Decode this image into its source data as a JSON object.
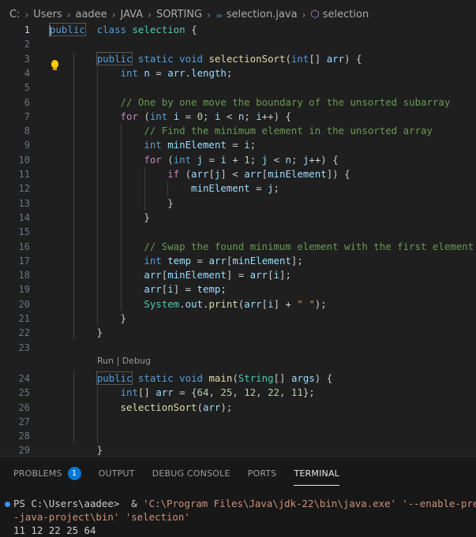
{
  "breadcrumb": {
    "drive": "C:",
    "folders": [
      "Users",
      "aadee",
      "JAVA",
      "SORTING"
    ],
    "file": "selection.java",
    "symbol": "selection",
    "file_icon": "java-file-icon",
    "symbol_icon": "class-symbol-icon"
  },
  "editor": {
    "codelens": "Run | Debug",
    "lines": [
      {
        "n": "1",
        "tokens": [
          [
            "kw hl",
            "public"
          ],
          [
            "",
            "  "
          ],
          [
            "kw",
            "class"
          ],
          [
            "",
            " "
          ],
          [
            "ty",
            "selection"
          ],
          [
            "",
            " {"
          ]
        ]
      },
      {
        "n": "2",
        "tokens": []
      },
      {
        "n": "3",
        "tokens": [
          [
            "",
            "        "
          ],
          [
            "kw hl",
            "public"
          ],
          [
            "",
            " "
          ],
          [
            "kw",
            "static"
          ],
          [
            "",
            " "
          ],
          [
            "kw",
            "void"
          ],
          [
            "",
            " "
          ],
          [
            "fn",
            "selectionSort"
          ],
          [
            "",
            "("
          ],
          [
            "kw",
            "int"
          ],
          [
            "",
            "[] "
          ],
          [
            "var",
            "arr"
          ],
          [
            "",
            ") {"
          ]
        ]
      },
      {
        "n": "4",
        "tokens": [
          [
            "",
            "            "
          ],
          [
            "kw",
            "int"
          ],
          [
            "",
            " "
          ],
          [
            "var",
            "n"
          ],
          [
            "",
            " = "
          ],
          [
            "var",
            "arr"
          ],
          [
            "",
            "."
          ],
          [
            "var",
            "length"
          ],
          [
            "",
            ";"
          ]
        ]
      },
      {
        "n": "5",
        "tokens": []
      },
      {
        "n": "6",
        "tokens": [
          [
            "",
            "            "
          ],
          [
            "cm",
            "// One by one move the boundary of the unsorted subarray"
          ]
        ]
      },
      {
        "n": "7",
        "tokens": [
          [
            "",
            "            "
          ],
          [
            "ctl",
            "for"
          ],
          [
            "",
            " ("
          ],
          [
            "kw",
            "int"
          ],
          [
            "",
            " "
          ],
          [
            "var",
            "i"
          ],
          [
            "",
            " = "
          ],
          [
            "num",
            "0"
          ],
          [
            "",
            "; "
          ],
          [
            "var",
            "i"
          ],
          [
            "",
            " < "
          ],
          [
            "var",
            "n"
          ],
          [
            "",
            "; "
          ],
          [
            "var",
            "i"
          ],
          [
            "",
            "++) {"
          ]
        ]
      },
      {
        "n": "8",
        "tokens": [
          [
            "",
            "                "
          ],
          [
            "cm",
            "// Find the minimum element in the unsorted array"
          ]
        ]
      },
      {
        "n": "9",
        "tokens": [
          [
            "",
            "                "
          ],
          [
            "kw",
            "int"
          ],
          [
            "",
            " "
          ],
          [
            "var",
            "minElement"
          ],
          [
            "",
            " = "
          ],
          [
            "var",
            "i"
          ],
          [
            "",
            ";"
          ]
        ]
      },
      {
        "n": "10",
        "tokens": [
          [
            "",
            "                "
          ],
          [
            "ctl",
            "for"
          ],
          [
            "",
            " ("
          ],
          [
            "kw",
            "int"
          ],
          [
            "",
            " "
          ],
          [
            "var",
            "j"
          ],
          [
            "",
            " = "
          ],
          [
            "var",
            "i"
          ],
          [
            "",
            " + "
          ],
          [
            "num",
            "1"
          ],
          [
            "",
            "; "
          ],
          [
            "var",
            "j"
          ],
          [
            "",
            " < "
          ],
          [
            "var",
            "n"
          ],
          [
            "",
            "; "
          ],
          [
            "var",
            "j"
          ],
          [
            "",
            "++) {"
          ]
        ]
      },
      {
        "n": "11",
        "tokens": [
          [
            "",
            "                    "
          ],
          [
            "ctl",
            "if"
          ],
          [
            "",
            " ("
          ],
          [
            "var",
            "arr"
          ],
          [
            "",
            "["
          ],
          [
            "var",
            "j"
          ],
          [
            "",
            "] < "
          ],
          [
            "var",
            "arr"
          ],
          [
            "",
            "["
          ],
          [
            "var",
            "minElement"
          ],
          [
            "",
            "]) {"
          ]
        ]
      },
      {
        "n": "12",
        "tokens": [
          [
            "",
            "                        "
          ],
          [
            "var",
            "minElement"
          ],
          [
            "",
            " = "
          ],
          [
            "var",
            "j"
          ],
          [
            "",
            ";"
          ]
        ]
      },
      {
        "n": "13",
        "tokens": [
          [
            "",
            "                    }"
          ]
        ]
      },
      {
        "n": "14",
        "tokens": [
          [
            "",
            "                }"
          ]
        ]
      },
      {
        "n": "15",
        "tokens": []
      },
      {
        "n": "16",
        "tokens": [
          [
            "",
            "                "
          ],
          [
            "cm",
            "// Swap the found minimum element with the first element"
          ]
        ]
      },
      {
        "n": "17",
        "tokens": [
          [
            "",
            "                "
          ],
          [
            "kw",
            "int"
          ],
          [
            "",
            " "
          ],
          [
            "var",
            "temp"
          ],
          [
            "",
            " = "
          ],
          [
            "var",
            "arr"
          ],
          [
            "",
            "["
          ],
          [
            "var",
            "minElement"
          ],
          [
            "",
            "];"
          ]
        ]
      },
      {
        "n": "18",
        "tokens": [
          [
            "",
            "                "
          ],
          [
            "var",
            "arr"
          ],
          [
            "",
            "["
          ],
          [
            "var",
            "minElement"
          ],
          [
            "",
            "] = "
          ],
          [
            "var",
            "arr"
          ],
          [
            "",
            "["
          ],
          [
            "var",
            "i"
          ],
          [
            "",
            "];"
          ]
        ]
      },
      {
        "n": "19",
        "tokens": [
          [
            "",
            "                "
          ],
          [
            "var",
            "arr"
          ],
          [
            "",
            "["
          ],
          [
            "var",
            "i"
          ],
          [
            "",
            "] = "
          ],
          [
            "var",
            "temp"
          ],
          [
            "",
            ";"
          ]
        ]
      },
      {
        "n": "20",
        "tokens": [
          [
            "",
            "                "
          ],
          [
            "ty",
            "System"
          ],
          [
            "",
            "."
          ],
          [
            "var",
            "out"
          ],
          [
            "",
            "."
          ],
          [
            "fn",
            "print"
          ],
          [
            "",
            "("
          ],
          [
            "var",
            "arr"
          ],
          [
            "",
            "["
          ],
          [
            "var",
            "i"
          ],
          [
            "",
            "] + "
          ],
          [
            "str",
            "\" \""
          ],
          [
            "",
            ");"
          ]
        ]
      },
      {
        "n": "21",
        "tokens": [
          [
            "",
            "            }"
          ]
        ]
      },
      {
        "n": "22",
        "tokens": [
          [
            "",
            "        }"
          ]
        ]
      },
      {
        "n": "23",
        "tokens": []
      },
      {
        "n": "24",
        "tokens": [
          [
            "",
            "        "
          ],
          [
            "kw hl",
            "public"
          ],
          [
            "",
            " "
          ],
          [
            "kw",
            "static"
          ],
          [
            "",
            " "
          ],
          [
            "kw",
            "void"
          ],
          [
            "",
            " "
          ],
          [
            "fn",
            "main"
          ],
          [
            "",
            "("
          ],
          [
            "ty",
            "String"
          ],
          [
            "",
            "[] "
          ],
          [
            "var",
            "args"
          ],
          [
            "",
            ") {"
          ]
        ]
      },
      {
        "n": "25",
        "tokens": [
          [
            "",
            "            "
          ],
          [
            "kw",
            "int"
          ],
          [
            "",
            "[] "
          ],
          [
            "var",
            "arr"
          ],
          [
            "",
            " = {"
          ],
          [
            "num",
            "64"
          ],
          [
            "",
            ", "
          ],
          [
            "num",
            "25"
          ],
          [
            "",
            ", "
          ],
          [
            "num",
            "12"
          ],
          [
            "",
            ", "
          ],
          [
            "num",
            "22"
          ],
          [
            "",
            ", "
          ],
          [
            "num",
            "11"
          ],
          [
            "",
            "};"
          ]
        ]
      },
      {
        "n": "26",
        "tokens": [
          [
            "",
            "            "
          ],
          [
            "fn",
            "selectionSort"
          ],
          [
            "",
            "("
          ],
          [
            "var",
            "arr"
          ],
          [
            "",
            ");"
          ]
        ]
      },
      {
        "n": "27",
        "tokens": []
      },
      {
        "n": "28",
        "tokens": []
      },
      {
        "n": "29",
        "tokens": [
          [
            "",
            "        }"
          ]
        ]
      }
    ]
  },
  "panel": {
    "tabs": [
      {
        "label": "PROBLEMS",
        "badge": "1"
      },
      {
        "label": "OUTPUT"
      },
      {
        "label": "DEBUG CONSOLE"
      },
      {
        "label": "PORTS"
      },
      {
        "label": "TERMINAL",
        "active": true
      }
    ],
    "terminal": {
      "prompt": "PS C:\\Users\\aadee> ",
      "command_amp": " & ",
      "command_exe": "'C:\\Program Files\\Java\\jdk-22\\bin\\java.exe'",
      "command_flag": " '--enable-previ",
      "line2_path": "-java-project\\bin'",
      "line2_class": " 'selection'",
      "output": "11 12 22 25 64"
    }
  }
}
